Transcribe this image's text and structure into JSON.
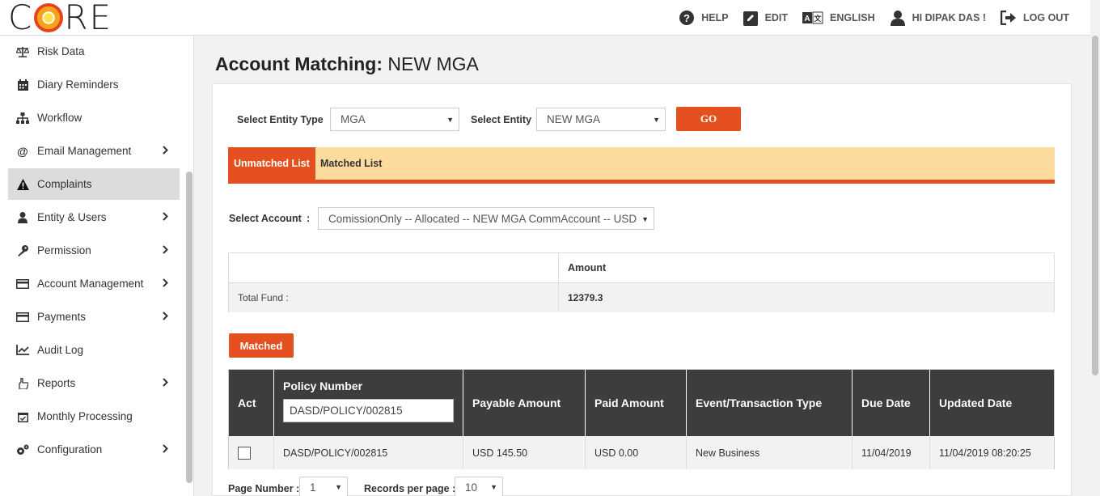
{
  "header": {
    "logo_text": "CORE",
    "nav": {
      "help": "HELP",
      "edit": "EDIT",
      "language": "ENGLISH",
      "user": "HI DIPAK DAS !",
      "logout": "LOG OUT"
    }
  },
  "sidebar": {
    "items": [
      {
        "label": "Risk Data",
        "icon": "scale-icon"
      },
      {
        "label": "Diary Reminders",
        "icon": "calendar-icon"
      },
      {
        "label": "Workflow",
        "icon": "sitemap-icon"
      },
      {
        "label": "Email Management",
        "icon": "at-icon"
      },
      {
        "label": "Complaints",
        "icon": "warning-icon"
      },
      {
        "label": "Entity & Users",
        "icon": "user-icon"
      },
      {
        "label": "Permission",
        "icon": "key-icon"
      },
      {
        "label": "Account Management",
        "icon": "card-icon"
      },
      {
        "label": "Payments",
        "icon": "card-icon"
      },
      {
        "label": "Audit Log",
        "icon": "chart-icon"
      },
      {
        "label": "Reports",
        "icon": "hand-icon"
      },
      {
        "label": "Monthly Processing",
        "icon": "calendar-check-icon"
      },
      {
        "label": "Configuration",
        "icon": "cogs-icon"
      }
    ]
  },
  "page": {
    "title_bold": "Account Matching:",
    "title_rest": " NEW MGA"
  },
  "filters": {
    "entity_type_label": "Select Entity Type",
    "entity_type_value": "MGA",
    "entity_label": "Select Entity",
    "entity_value": "NEW MGA",
    "go_label": "GO"
  },
  "tabs": {
    "unmatched": "Unmatched List",
    "matched": "Matched List"
  },
  "account": {
    "label": "Select Account",
    "colon": ":",
    "value": "ComissionOnly -- Allocated -- NEW MGA CommAccount -- USD"
  },
  "fund": {
    "amount_header": "Amount",
    "total_label": "Total Fund :",
    "total_value": "12379.3"
  },
  "matched_button": "Matched",
  "grid": {
    "headers": {
      "act": "Act",
      "policy": "Policy Number",
      "payable": "Payable Amount",
      "paid": "Paid Amount",
      "event": "Event/Transaction Type",
      "due": "Due Date",
      "updated": "Updated Date"
    },
    "policy_filter_value": "DASD/POLICY/002815",
    "rows": [
      {
        "policy": "DASD/POLICY/002815",
        "payable": "USD 145.50",
        "paid": "USD 0.00",
        "event": "New Business",
        "due": "11/04/2019",
        "updated": "11/04/2019 08:20:25"
      }
    ]
  },
  "pager": {
    "page_label": "Page Number :",
    "page_value": "1",
    "records_label": "Records per page :",
    "records_value": "10"
  },
  "colors": {
    "accent": "#e4501f",
    "tab_bar": "#fddb9f",
    "grid_header": "#3d3d3d"
  }
}
